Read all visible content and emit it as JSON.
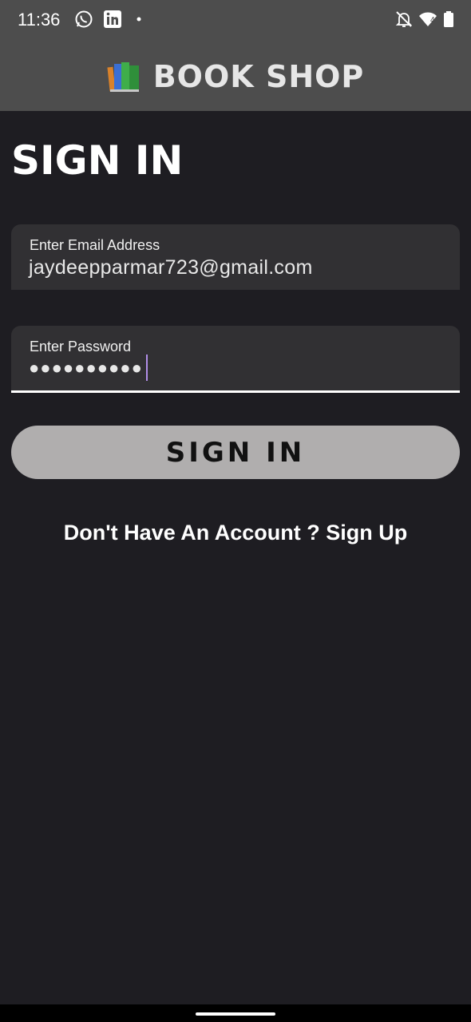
{
  "status_bar": {
    "time": "11:36",
    "left_icons": [
      "whatsapp-icon",
      "linkedin-icon",
      "dot-icon"
    ],
    "right_icons": [
      "notifications-off-icon",
      "wifi-icon",
      "battery-icon"
    ],
    "wifi_badge": "4"
  },
  "app_bar": {
    "logo_icon": "books-icon",
    "title": "BOOK SHOP"
  },
  "page": {
    "title": "SIGN IN"
  },
  "email_field": {
    "label": "Enter Email Address",
    "value": "jaydeepparmar723@gmail.com"
  },
  "password_field": {
    "label": "Enter Password",
    "value": "●●●●●●●●●●",
    "focused": true
  },
  "signin_button": {
    "label": "SIGN IN"
  },
  "signup_link": {
    "text": "Don't Have An Account ? Sign Up"
  },
  "colors": {
    "background": "#1e1d22",
    "app_bar": "#4d4d4d",
    "field": "#313033",
    "button": "#b0aeae",
    "caret": "#b18ee8"
  }
}
